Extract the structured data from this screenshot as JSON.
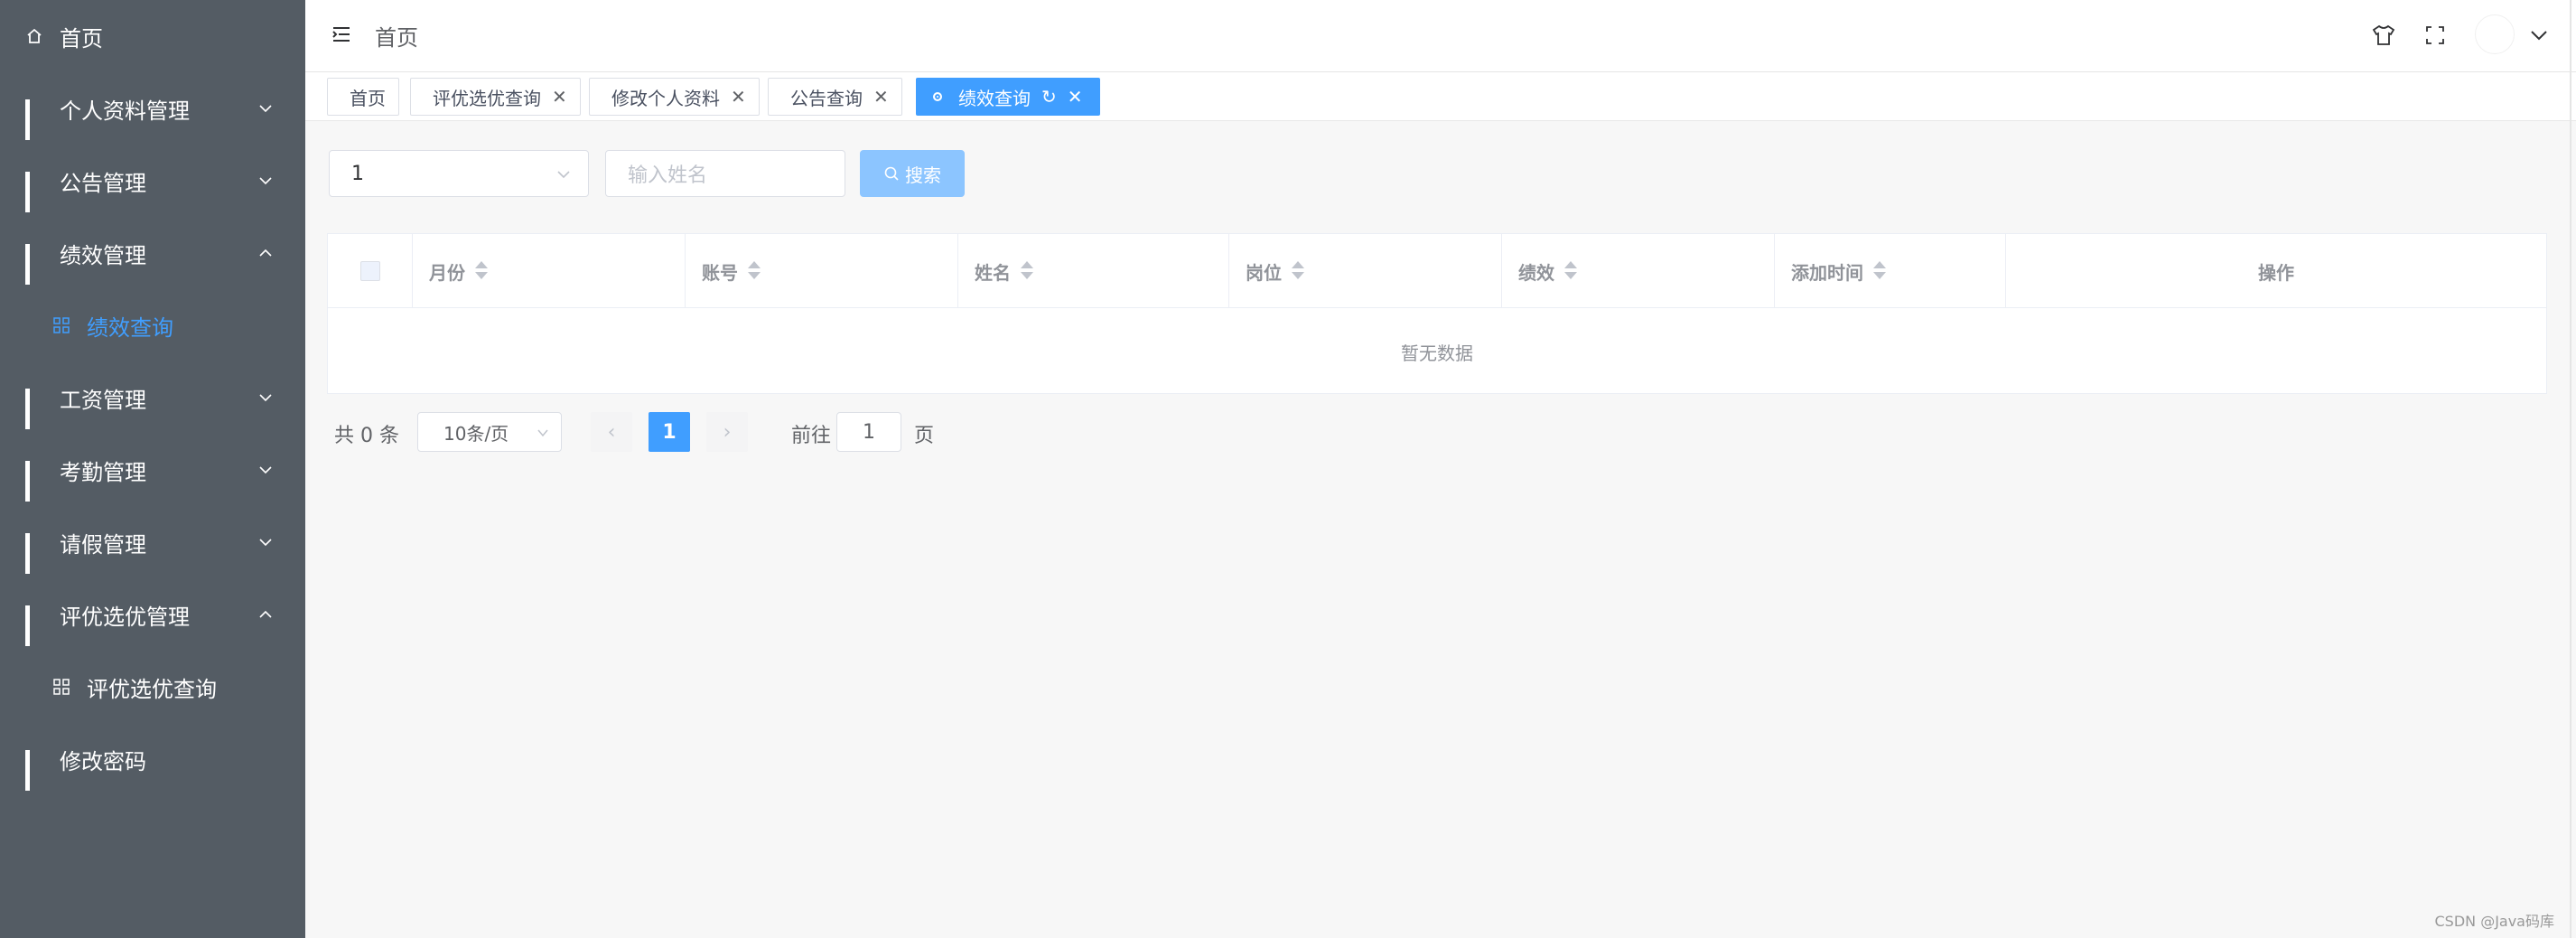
{
  "sidebar": {
    "items": [
      {
        "label": "首页"
      },
      {
        "label": "个人资料管理"
      },
      {
        "label": "公告管理"
      },
      {
        "label": "绩效管理"
      },
      {
        "label": "绩效查询"
      },
      {
        "label": "工资管理"
      },
      {
        "label": "考勤管理"
      },
      {
        "label": "请假管理"
      },
      {
        "label": "评优选优管理"
      },
      {
        "label": "评优选优查询"
      },
      {
        "label": "修改密码"
      }
    ]
  },
  "header": {
    "breadcrumb": "首页"
  },
  "tabs": [
    {
      "label": "首页"
    },
    {
      "label": "评优选优查询"
    },
    {
      "label": "修改个人资料"
    },
    {
      "label": "公告查询"
    },
    {
      "label": "绩效查询"
    }
  ],
  "filters": {
    "select_value": "1",
    "name_placeholder": "输入姓名",
    "search_label": "搜索"
  },
  "table": {
    "columns": [
      "月份",
      "账号",
      "姓名",
      "岗位",
      "绩效",
      "添加时间",
      "操作"
    ],
    "empty_text": "暂无数据"
  },
  "pagination": {
    "total_text": "共 0 条",
    "page_size": "10条/页",
    "current_page": "1",
    "goto_label": "前往",
    "goto_value": "1",
    "page_suffix": "页"
  },
  "watermark": "CSDN @Java码库",
  "colors": {
    "sidebar_bg": "#545c64",
    "accent": "#409eff",
    "search_button": "#8cc5ff"
  }
}
